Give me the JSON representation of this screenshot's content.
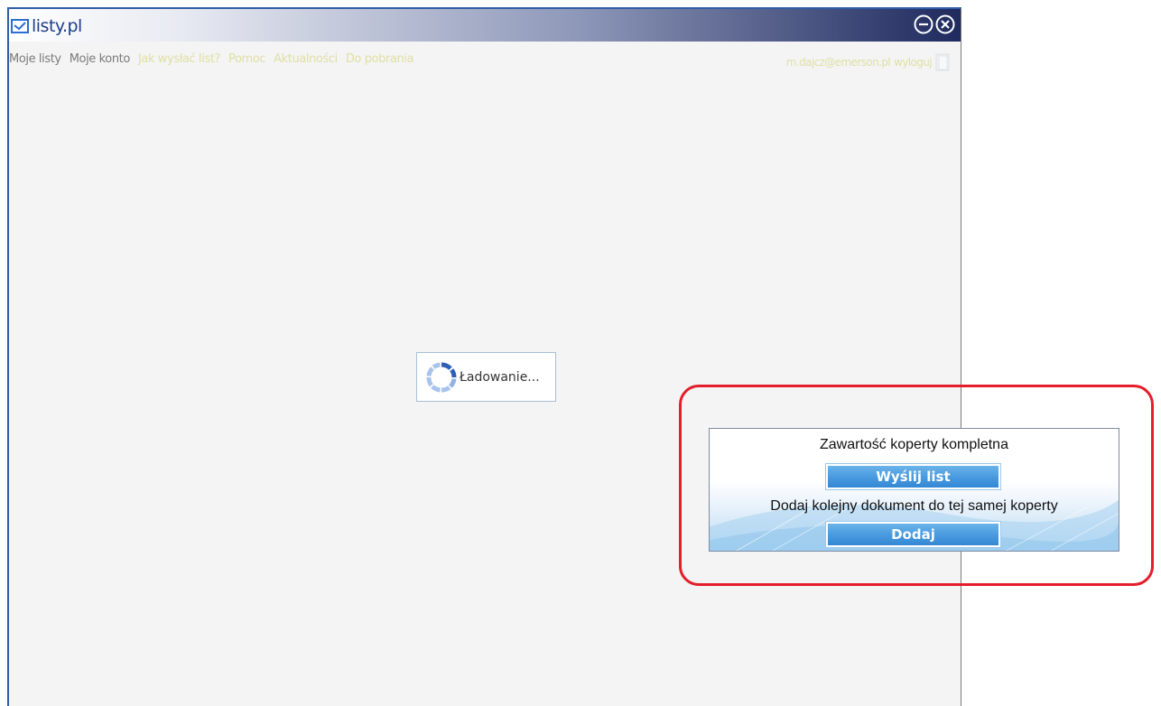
{
  "window": {
    "logo_text": "listy.pl"
  },
  "nav": {
    "items": [
      {
        "label": "Moje listy",
        "style": "dark"
      },
      {
        "label": "Moje konto",
        "style": "dark"
      },
      {
        "label": "Jak wysłać list?",
        "style": "light"
      },
      {
        "label": "Pomoc",
        "style": "light"
      },
      {
        "label": "Aktualności",
        "style": "light"
      },
      {
        "label": "Do pobrania",
        "style": "light"
      }
    ],
    "user_email": "m.dajcz@emerson.pl",
    "logout_label": "wyloguj"
  },
  "loading": {
    "text": "Ładowanie..."
  },
  "popup": {
    "complete_text": "Zawartość koperty kompletna",
    "send_button": "Wyślij list",
    "add_text": "Dodaj kolejny dokument do tej samej koperty",
    "add_button": "Dodaj"
  },
  "colors": {
    "accent": "#2f5ea8",
    "highlight_border": "#e41e2b",
    "button_blue": "#4a9be0",
    "nav_dark": "#7b7b7b",
    "nav_light": "#dfe0a6"
  }
}
